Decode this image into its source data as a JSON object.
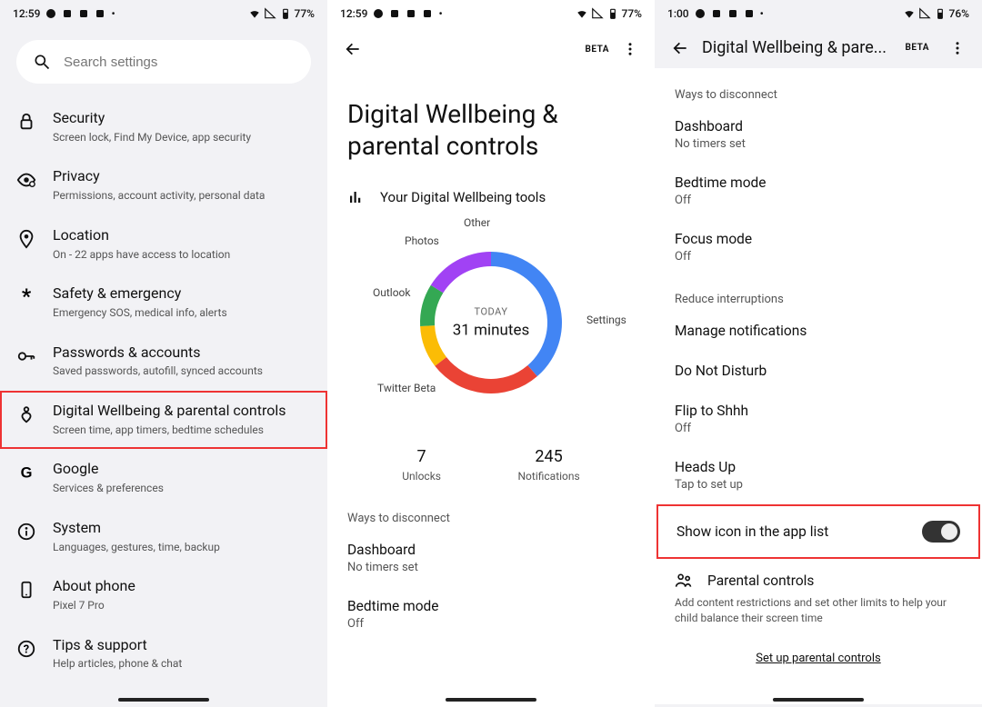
{
  "status": {
    "time1": "12:59",
    "time2": "12:59",
    "time3": "1:00",
    "battery1": "77%",
    "battery2": "77%",
    "battery3": "76%"
  },
  "search": {
    "placeholder": "Search settings"
  },
  "settings": [
    {
      "icon": "lock",
      "title": "Security",
      "sub": "Screen lock, Find My Device, app security"
    },
    {
      "icon": "eye",
      "title": "Privacy",
      "sub": "Permissions, account activity, personal data"
    },
    {
      "icon": "pin",
      "title": "Location",
      "sub": "On - 22 apps have access to location"
    },
    {
      "icon": "asterisk",
      "title": "Safety & emergency",
      "sub": "Emergency SOS, medical info, alerts"
    },
    {
      "icon": "key",
      "title": "Passwords & accounts",
      "sub": "Saved passwords, autofill, synced accounts"
    },
    {
      "icon": "heart",
      "title": "Digital Wellbeing & parental controls",
      "sub": "Screen time, app timers, bedtime schedules",
      "highlighted": true
    },
    {
      "icon": "google",
      "title": "Google",
      "sub": "Services & preferences"
    },
    {
      "icon": "info",
      "title": "System",
      "sub": "Languages, gestures, time, backup"
    },
    {
      "icon": "phone",
      "title": "About phone",
      "sub": "Pixel 7 Pro"
    },
    {
      "icon": "help",
      "title": "Tips & support",
      "sub": "Help articles, phone & chat"
    }
  ],
  "dw": {
    "beta": "BETA",
    "title": "Digital Wellbeing & parental controls",
    "tools_head": "Your Digital Wellbeing tools",
    "center_label": "TODAY",
    "center_value": "31 minutes",
    "stats": [
      {
        "num": "7",
        "label": "Unlocks"
      },
      {
        "num": "245",
        "label": "Notifications"
      }
    ],
    "ways_caption": "Ways to disconnect",
    "items2": [
      {
        "title": "Dashboard",
        "sub": "No timers set"
      },
      {
        "title": "Bedtime mode",
        "sub": "Off"
      }
    ]
  },
  "chart_data": {
    "type": "pie",
    "title": "Your Digital Wellbeing tools",
    "center_label": "TODAY",
    "center_value": "31 minutes",
    "series": [
      {
        "name": "Settings",
        "value": 12,
        "color": "#4285F4"
      },
      {
        "name": "Twitter Beta",
        "value": 8,
        "color": "#EA4335"
      },
      {
        "name": "Outlook",
        "value": 3,
        "color": "#FBBC05"
      },
      {
        "name": "Photos",
        "value": 3,
        "color": "#34A853"
      },
      {
        "name": "Other",
        "value": 5,
        "color": "#A142F4"
      }
    ]
  },
  "p3": {
    "title": "Digital Wellbeing & pare...",
    "ways_caption": "Ways to disconnect",
    "reduce_caption": "Reduce interruptions",
    "items_a": [
      {
        "title": "Dashboard",
        "sub": "No timers set"
      },
      {
        "title": "Bedtime mode",
        "sub": "Off"
      },
      {
        "title": "Focus mode",
        "sub": "Off"
      }
    ],
    "items_b": [
      {
        "title": "Manage notifications",
        "sub": ""
      },
      {
        "title": "Do Not Disturb",
        "sub": ""
      },
      {
        "title": "Flip to Shhh",
        "sub": "Off"
      },
      {
        "title": "Heads Up",
        "sub": "Tap to set up"
      }
    ],
    "toggle_label": "Show icon in the app list",
    "pc_title": "Parental controls",
    "pc_desc": "Add content restrictions and set other limits to help your child balance their screen time",
    "pc_link": "Set up parental controls"
  }
}
